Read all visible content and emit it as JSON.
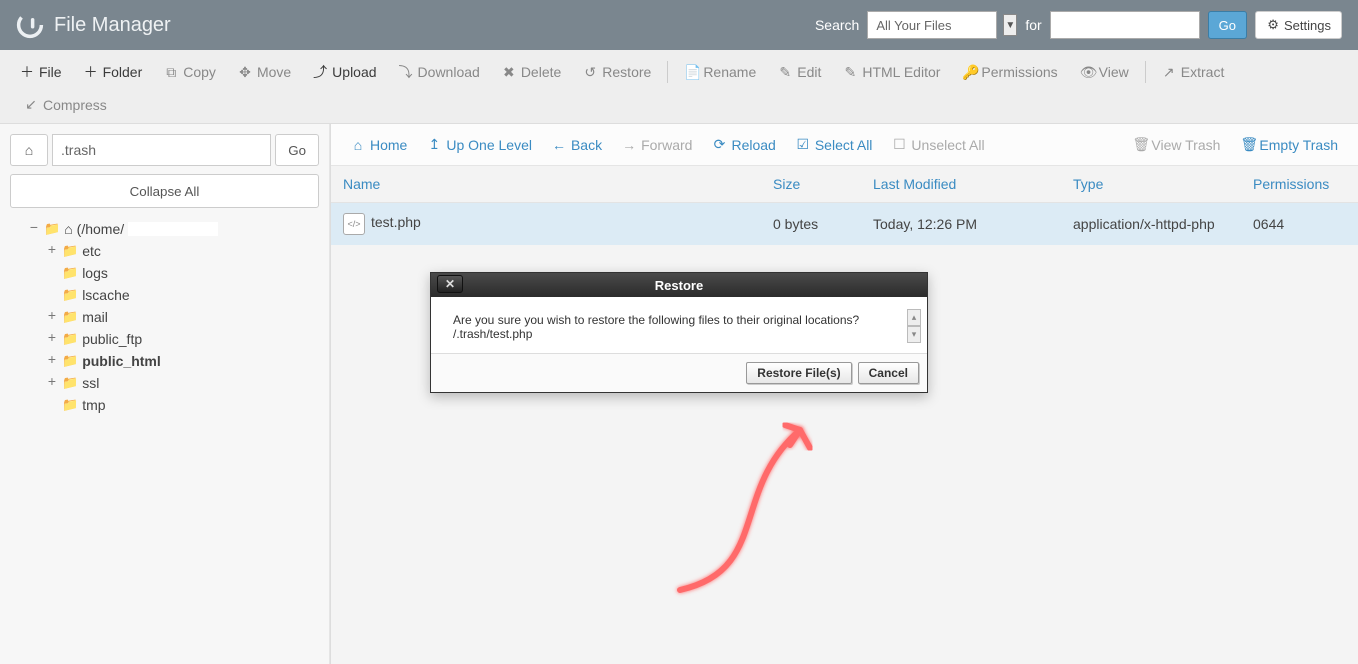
{
  "header": {
    "app_title": "File Manager",
    "search_label": "Search",
    "search_scope": "All Your Files",
    "for_label": "for",
    "search_value": "",
    "go_label": "Go",
    "settings_label": "Settings"
  },
  "toolbar": {
    "file": "File",
    "folder": "Folder",
    "copy": "Copy",
    "move": "Move",
    "upload": "Upload",
    "download": "Download",
    "delete": "Delete",
    "restore": "Restore",
    "rename": "Rename",
    "edit": "Edit",
    "html_editor": "HTML Editor",
    "permissions": "Permissions",
    "view": "View",
    "extract": "Extract",
    "compress": "Compress"
  },
  "sidebar": {
    "path_value": ".trash",
    "go_label": "Go",
    "collapse_label": "Collapse All",
    "tree_root": "(/home/",
    "items": [
      {
        "label": "etc",
        "expandable": true
      },
      {
        "label": "logs",
        "expandable": false
      },
      {
        "label": "lscache",
        "expandable": false
      },
      {
        "label": "mail",
        "expandable": true
      },
      {
        "label": "public_ftp",
        "expandable": true
      },
      {
        "label": "public_html",
        "expandable": true,
        "bold": true
      },
      {
        "label": "ssl",
        "expandable": true
      },
      {
        "label": "tmp",
        "expandable": false
      }
    ]
  },
  "content_toolbar": {
    "home": "Home",
    "up": "Up One Level",
    "back": "Back",
    "forward": "Forward",
    "reload": "Reload",
    "select_all": "Select All",
    "unselect_all": "Unselect All",
    "view_trash": "View Trash",
    "empty_trash": "Empty Trash"
  },
  "table": {
    "headers": {
      "name": "Name",
      "size": "Size",
      "modified": "Last Modified",
      "type": "Type",
      "perm": "Permissions"
    },
    "rows": [
      {
        "name": "test.php",
        "size": "0 bytes",
        "modified": "Today, 12:26 PM",
        "type": "application/x-httpd-php",
        "perm": "0644"
      }
    ]
  },
  "dialog": {
    "title": "Restore",
    "message": "Are you sure you wish to restore the following files to their original locations?",
    "file_path": "/.trash/test.php",
    "restore_btn": "Restore File(s)",
    "cancel_btn": "Cancel"
  }
}
